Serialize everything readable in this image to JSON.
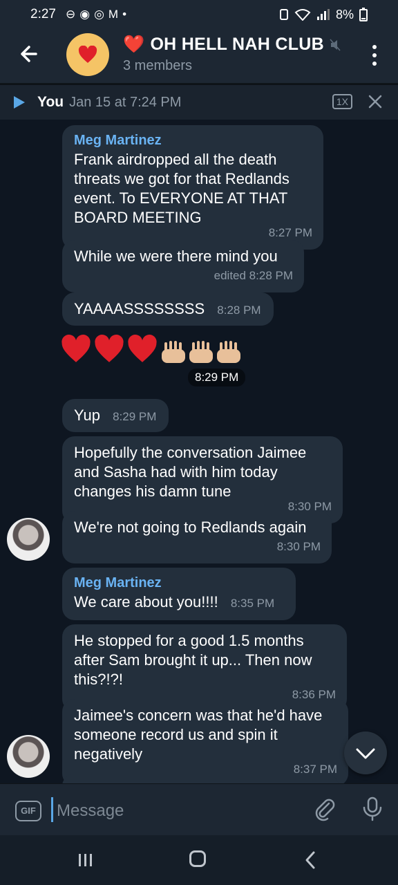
{
  "status_bar": {
    "time": "2:27",
    "icons": [
      "⊖",
      "◉",
      "◎",
      "M",
      "•"
    ],
    "battery": "8%"
  },
  "header": {
    "title": "OH HELL NAH CLUB",
    "title_prefix": "❤️",
    "subtitle": "3 members"
  },
  "pinned": {
    "author": "You",
    "date": "Jan 15 at 7:24 PM",
    "speed": "1X"
  },
  "messages": [
    {
      "sender": "Meg Martinez",
      "text": "Frank airdropped all the death threats we got for that Redlands event. To EVERYONE AT THAT BOARD MEETING",
      "time": "8:27 PM"
    },
    {
      "text": "While we were there mind you",
      "time": "edited 8:28 PM"
    },
    {
      "text": "YAAAASSSSSSSS",
      "time": "8:28 PM"
    },
    {
      "text": "❤️❤️❤️🙌🏼🙌🏼🙌🏼",
      "time": "8:29 PM"
    },
    {
      "text": "Yup",
      "time": "8:29 PM"
    },
    {
      "text": "Hopefully the conversation Jaimee and Sasha had with him today changes his damn tune",
      "time": "8:30 PM"
    },
    {
      "text": "We're not going to Redlands again",
      "time": "8:30 PM"
    },
    {
      "sender": "Meg Martinez",
      "text": "We care about you!!!!",
      "time": "8:35 PM"
    },
    {
      "text": "He stopped for a good 1.5 months after Sam brought it up... Then now this?!?!",
      "time": "8:36 PM"
    },
    {
      "text": "Jaimee's concern was that he'd have someone record us and spin it negatively",
      "time": "8:37 PM"
    }
  ],
  "composer": {
    "gif_label": "GIF",
    "placeholder": "Message"
  },
  "colors": {
    "header_bg": "#1d2733",
    "chat_bg": "#0e1621",
    "bubble_bg": "#232f3c",
    "accent": "#6ab3f3"
  }
}
